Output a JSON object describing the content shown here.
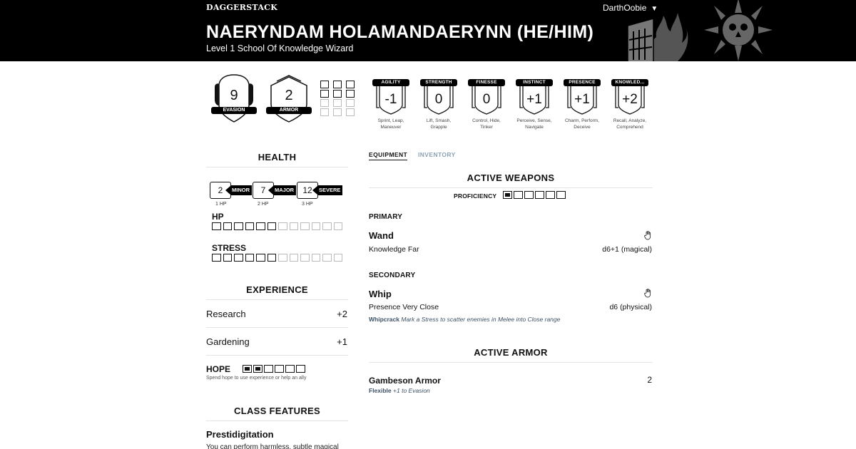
{
  "header": {
    "brand": "DAGGERSTACK",
    "user": "DarthOobie",
    "character_name": "NAERYNDAM HOLAMANDAERYNN (HE/HIM)",
    "character_subtitle": "Level 1 School Of Knowledge Wizard"
  },
  "defense": {
    "evasion": {
      "value": "9",
      "label": "EVASION"
    },
    "armor": {
      "value": "2",
      "label": "ARMOR"
    },
    "armor_slots_total": 12,
    "armor_slots_active": 6
  },
  "traits": [
    {
      "label": "AGILITY",
      "value": "-1",
      "desc1": "Sprint, Leap,",
      "desc2": "Maneuver"
    },
    {
      "label": "STRENGTH",
      "value": "0",
      "desc1": "Lift, Smash,",
      "desc2": "Grapple"
    },
    {
      "label": "FINESSE",
      "value": "0",
      "desc1": "Control, Hide,",
      "desc2": "Tinker"
    },
    {
      "label": "INSTINCT",
      "value": "+1",
      "desc1": "Perceive, Sense,",
      "desc2": "Navigate"
    },
    {
      "label": "PRESENCE",
      "value": "+1",
      "desc1": "Charm, Perform,",
      "desc2": "Deceive"
    },
    {
      "label": "KNOWLED...",
      "value": "+2",
      "desc1": "Recall, Analyze,",
      "desc2": "Comprehend"
    }
  ],
  "health": {
    "title": "HEALTH",
    "thresholds": [
      {
        "value": "2",
        "tag": "MINOR",
        "hp": "1 HP"
      },
      {
        "value": "7",
        "tag": "MAJOR",
        "hp": "2 HP"
      },
      {
        "value": "12",
        "tag": "SEVERE",
        "hp": "3 HP"
      }
    ],
    "hp_label": "HP",
    "hp_active": 6,
    "hp_total": 12,
    "stress_label": "STRESS",
    "stress_active": 6,
    "stress_total": 12
  },
  "experience": {
    "title": "EXPERIENCE",
    "items": [
      {
        "name": "Research",
        "value": "+2"
      },
      {
        "name": "Gardening",
        "value": "+1"
      }
    ]
  },
  "hope": {
    "label": "HOPE",
    "filled": 2,
    "total": 6,
    "description": "Spend hope to use experience or help an ally"
  },
  "class_features": {
    "title": "CLASS FEATURES",
    "items": [
      {
        "name": "Prestidigitation",
        "text": "You can perform harmless, subtle magical"
      }
    ]
  },
  "tabs": {
    "equipment": "EQUIPMENT",
    "inventory": "INVENTORY"
  },
  "weapons": {
    "title": "ACTIVE WEAPONS",
    "proficiency_label": "PROFICIENCY",
    "proficiency_filled": 1,
    "proficiency_total": 6,
    "primary": {
      "heading": "PRIMARY",
      "name": "Wand",
      "meta": "Knowledge Far",
      "damage": "d6+1 (magical)"
    },
    "secondary": {
      "heading": "SECONDARY",
      "name": "Whip",
      "meta": "Presence Very Close",
      "damage": "d6 (physical)",
      "feature_name": "Whipcrack",
      "feature_text": "Mark a Stress to scatter enemies in Melee into Close range"
    }
  },
  "armor": {
    "title": "ACTIVE ARMOR",
    "name": "Gambeson Armor",
    "score": "2",
    "feature_name": "Flexible",
    "feature_text": "+1 to Evasion"
  },
  "icons": {
    "user_menu": "caret-down-icon",
    "class_emblem": "book-flame-icon",
    "domain_emblem": "sun-skull-icon",
    "weapon_hand": "hand-icon"
  }
}
